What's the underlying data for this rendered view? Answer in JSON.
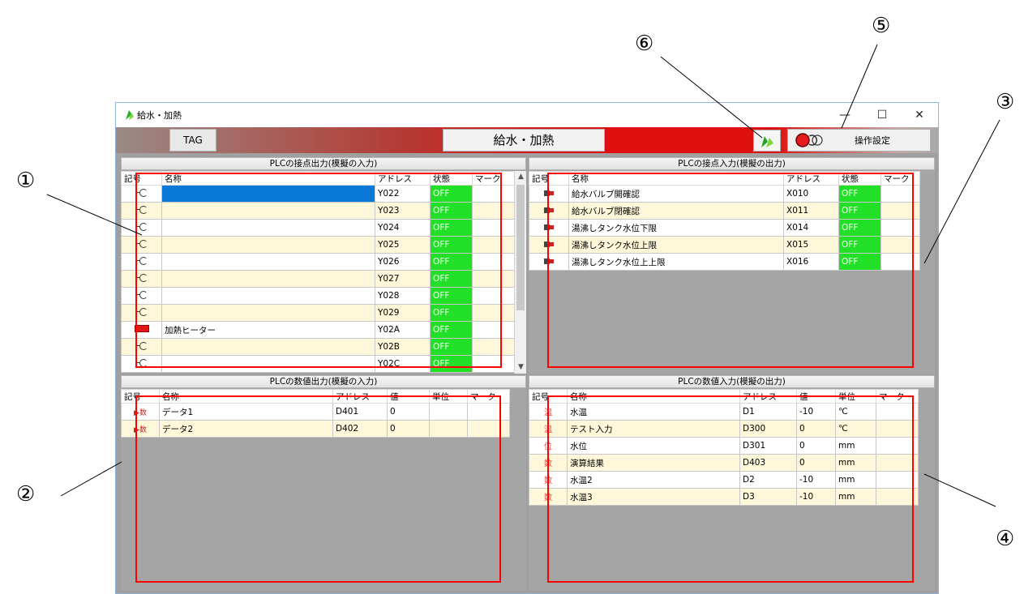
{
  "callouts": [
    "①",
    "②",
    "③",
    "④",
    "⑤",
    "⑥"
  ],
  "window": {
    "title": "給水・加熱",
    "controls": {
      "min": "—",
      "max": "☐",
      "close": "✕"
    }
  },
  "toolbar": {
    "tag_label": "TAG",
    "screen_title": "給水・加熱",
    "operation_label": "操作設定"
  },
  "panels": {
    "contact_output": {
      "header": "PLCの接点出力(模擬の入力)",
      "columns": [
        "記号",
        "名称",
        "アドレス",
        "状態",
        "マーク"
      ],
      "rows": [
        {
          "symbol": "contact",
          "name": "",
          "address": "Y022",
          "state": "OFF",
          "mark": "",
          "selected": true
        },
        {
          "symbol": "contact",
          "name": "",
          "address": "Y023",
          "state": "OFF",
          "mark": ""
        },
        {
          "symbol": "contact",
          "name": "",
          "address": "Y024",
          "state": "OFF",
          "mark": ""
        },
        {
          "symbol": "contact",
          "name": "",
          "address": "Y025",
          "state": "OFF",
          "mark": ""
        },
        {
          "symbol": "contact",
          "name": "",
          "address": "Y026",
          "state": "OFF",
          "mark": ""
        },
        {
          "symbol": "contact",
          "name": "",
          "address": "Y027",
          "state": "OFF",
          "mark": ""
        },
        {
          "symbol": "contact",
          "name": "",
          "address": "Y028",
          "state": "OFF",
          "mark": ""
        },
        {
          "symbol": "contact",
          "name": "",
          "address": "Y029",
          "state": "OFF",
          "mark": ""
        },
        {
          "symbol": "heater",
          "name": "加熱ヒーター",
          "address": "Y02A",
          "state": "OFF",
          "mark": ""
        },
        {
          "symbol": "contact",
          "name": "",
          "address": "Y02B",
          "state": "OFF",
          "mark": ""
        },
        {
          "symbol": "contact",
          "name": "",
          "address": "Y02C",
          "state": "OFF",
          "mark": ""
        }
      ]
    },
    "contact_input": {
      "header": "PLCの接点入力(模擬の出力)",
      "columns": [
        "記号",
        "名称",
        "アドレス",
        "状態",
        "マーク"
      ],
      "rows": [
        {
          "symbol": "sensor",
          "name": "給水バルブ開確認",
          "address": "X010",
          "state": "OFF",
          "mark": ""
        },
        {
          "symbol": "sensor",
          "name": "給水バルブ閉確認",
          "address": "X011",
          "state": "OFF",
          "mark": ""
        },
        {
          "symbol": "sensor",
          "name": "湯沸しタンク水位下限",
          "address": "X014",
          "state": "OFF",
          "mark": ""
        },
        {
          "symbol": "sensor",
          "name": "湯沸しタンク水位上限",
          "address": "X015",
          "state": "OFF",
          "mark": ""
        },
        {
          "symbol": "sensor",
          "name": "湯沸しタンク水位上上限",
          "address": "X016",
          "state": "OFF",
          "mark": ""
        }
      ]
    },
    "numeric_output": {
      "header": "PLCの数値出力(模擬の入力)",
      "columns": [
        "記号",
        "名称",
        "アドレス",
        "値",
        "単位",
        "マーク"
      ],
      "rows": [
        {
          "symbol": "▶数",
          "name": "データ1",
          "address": "D401",
          "value": "0",
          "unit": "",
          "mark": ""
        },
        {
          "symbol": "▶数",
          "name": "データ2",
          "address": "D402",
          "value": "0",
          "unit": "",
          "mark": ""
        }
      ]
    },
    "numeric_input": {
      "header": "PLCの数値入力(模擬の出力)",
      "columns": [
        "記号",
        "名称",
        "アドレス",
        "値",
        "単位",
        "マーク"
      ],
      "rows": [
        {
          "symbol": "温",
          "name": "水温",
          "address": "D1",
          "value": "-10",
          "unit": "℃",
          "mark": ""
        },
        {
          "symbol": "温",
          "name": "テスト入力",
          "address": "D300",
          "value": "0",
          "unit": "℃",
          "mark": ""
        },
        {
          "symbol": "位",
          "name": "水位",
          "address": "D301",
          "value": "0",
          "unit": "mm",
          "mark": ""
        },
        {
          "symbol": "数",
          "name": "演算結果",
          "address": "D403",
          "value": "0",
          "unit": "mm",
          "mark": ""
        },
        {
          "symbol": "数",
          "name": "水温2",
          "address": "D2",
          "value": "-10",
          "unit": "mm",
          "mark": ""
        },
        {
          "symbol": "数",
          "name": "水温3",
          "address": "D3",
          "value": "-10",
          "unit": "mm",
          "mark": ""
        }
      ]
    }
  },
  "colors": {
    "highlight": "#ff0000",
    "state_on_bg": "#22e028",
    "selected": "#0a78d7"
  }
}
